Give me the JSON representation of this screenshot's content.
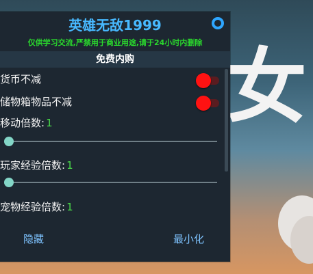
{
  "background": {
    "glyph": "女"
  },
  "panel": {
    "title": "英雄无敌1999",
    "warning": "仅供学习交流,严禁用于商业用途,请于24小时内删除",
    "section": "免费内购",
    "settings_icon": "gear-icon",
    "colors": {
      "title": "#48b9ff",
      "warning": "#2ad72d",
      "toggle_on": "#ff1212",
      "value": "#49da49",
      "button": "#7ec3ff"
    },
    "items": {
      "coins_label": "货币不减",
      "coins_on": true,
      "storage_label": "储物箱物品不减",
      "storage_on": true,
      "move_label": "移动倍数:",
      "move_value": "1",
      "move_level": 0.0,
      "player_exp_label": "玩家经验倍数:",
      "player_exp_value": "1",
      "player_exp_level": 0.0,
      "pet_exp_label": "宠物经验倍数:",
      "pet_exp_value": "1"
    },
    "buttons": {
      "hide": "隐藏",
      "minimize": "最小化"
    }
  }
}
